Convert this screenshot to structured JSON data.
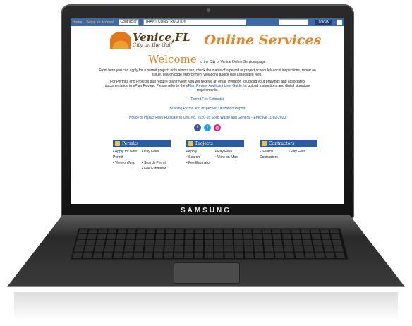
{
  "device": {
    "brand": "SAMSUNG"
  },
  "topbar": {
    "home": "Home",
    "setup": "Setup an Account",
    "role_select": "Contractor",
    "company_select": "TRANT CONSTRUCTION",
    "login": "LOGIN"
  },
  "logo": {
    "city": "Venice,FL",
    "tagline": "City on the Gulf"
  },
  "header": {
    "title": "Online Services"
  },
  "welcome": {
    "big": "Welcome",
    "rest": "to the City of Venice Online Services page."
  },
  "intro": "From here you can apply for a permit project, or business tax, check the status of a permit or project,schedule/cancel inspections, report an issue, search code enforcement violations and/or pay associated fees.",
  "plans": {
    "text": "For Permits and Projects that require plan review, you will receive an email invitation to upload your drawings and associated documentation to ePlan Review. Please refer to the",
    "link": "ePlan Review Applicant User Guide",
    "tail": "for upload instructions and digital signature requirements."
  },
  "links": {
    "estimator": "Permit Fee Estimator",
    "report": "Building Permit and Inspection Utilization Report",
    "notice": "Notice of impact Fees Pursuant to Ord. No. 2020-16 Solid Waste and General - Effective 11-02-2020"
  },
  "panels": {
    "permits": {
      "title": "Permits",
      "items": [
        "• Apply for New Permit",
        "• Pay Fees",
        "• View on Map",
        "• Search Permit",
        "",
        "• Fee Estimator"
      ]
    },
    "projects": {
      "title": "Projects",
      "items": [
        "• Apply",
        "• Pay Fees",
        "• Search",
        "• View on Map",
        "• Fee Estimator",
        ""
      ]
    },
    "contractors": {
      "title": "Contractors",
      "items": [
        "• Search Contractors",
        "• Pay Fees"
      ]
    }
  }
}
